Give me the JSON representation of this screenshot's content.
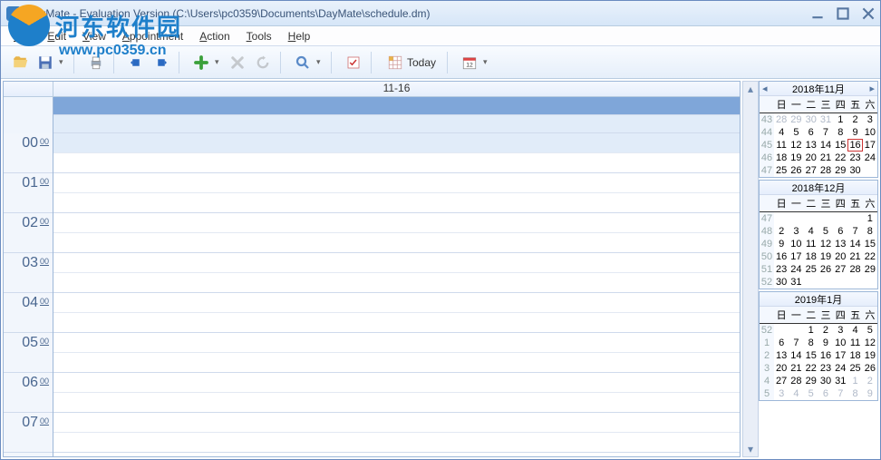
{
  "title": "DayMate - Evaluation Version (C:\\Users\\pc0359\\Documents\\DayMate\\schedule.dm)",
  "menu": {
    "file": "File",
    "edit": "Edit",
    "view": "View",
    "appointment": "Appointment",
    "action": "Action",
    "tools": "Tools",
    "help": "Help"
  },
  "toolbar": {
    "today": "Today"
  },
  "watermark": {
    "brand": "河东软件园",
    "url": "www.pc0359.cn"
  },
  "schedule": {
    "date_header": "11-16",
    "hours": [
      "00",
      "01",
      "02",
      "03",
      "04",
      "05",
      "06",
      "07"
    ],
    "minute_label": "00"
  },
  "calendars": [
    {
      "title": "2018年11月",
      "nav": true,
      "weekdays": [
        "日",
        "一",
        "二",
        "三",
        "四",
        "五",
        "六"
      ],
      "weeks": [
        {
          "wn": "43",
          "days": [
            {
              "d": "28",
              "dim": true
            },
            {
              "d": "29",
              "dim": true
            },
            {
              "d": "30",
              "dim": true
            },
            {
              "d": "31",
              "dim": true
            },
            {
              "d": "1"
            },
            {
              "d": "2"
            },
            {
              "d": "3"
            }
          ]
        },
        {
          "wn": "44",
          "days": [
            {
              "d": "4"
            },
            {
              "d": "5"
            },
            {
              "d": "6"
            },
            {
              "d": "7"
            },
            {
              "d": "8"
            },
            {
              "d": "9"
            },
            {
              "d": "10"
            }
          ]
        },
        {
          "wn": "45",
          "days": [
            {
              "d": "11"
            },
            {
              "d": "12"
            },
            {
              "d": "13"
            },
            {
              "d": "14"
            },
            {
              "d": "15"
            },
            {
              "d": "16",
              "today": true
            },
            {
              "d": "17"
            }
          ]
        },
        {
          "wn": "46",
          "days": [
            {
              "d": "18"
            },
            {
              "d": "19"
            },
            {
              "d": "20"
            },
            {
              "d": "21"
            },
            {
              "d": "22"
            },
            {
              "d": "23"
            },
            {
              "d": "24"
            }
          ]
        },
        {
          "wn": "47",
          "days": [
            {
              "d": "25"
            },
            {
              "d": "26"
            },
            {
              "d": "27"
            },
            {
              "d": "28"
            },
            {
              "d": "29"
            },
            {
              "d": "30"
            },
            {
              "d": ""
            }
          ]
        }
      ]
    },
    {
      "title": "2018年12月",
      "nav": false,
      "weekdays": [
        "日",
        "一",
        "二",
        "三",
        "四",
        "五",
        "六"
      ],
      "weeks": [
        {
          "wn": "47",
          "days": [
            {
              "d": ""
            },
            {
              "d": ""
            },
            {
              "d": ""
            },
            {
              "d": ""
            },
            {
              "d": ""
            },
            {
              "d": ""
            },
            {
              "d": "1"
            }
          ]
        },
        {
          "wn": "48",
          "days": [
            {
              "d": "2"
            },
            {
              "d": "3"
            },
            {
              "d": "4"
            },
            {
              "d": "5"
            },
            {
              "d": "6"
            },
            {
              "d": "7"
            },
            {
              "d": "8"
            }
          ]
        },
        {
          "wn": "49",
          "days": [
            {
              "d": "9"
            },
            {
              "d": "10"
            },
            {
              "d": "11"
            },
            {
              "d": "12"
            },
            {
              "d": "13"
            },
            {
              "d": "14"
            },
            {
              "d": "15"
            }
          ]
        },
        {
          "wn": "50",
          "days": [
            {
              "d": "16"
            },
            {
              "d": "17"
            },
            {
              "d": "18"
            },
            {
              "d": "19"
            },
            {
              "d": "20"
            },
            {
              "d": "21"
            },
            {
              "d": "22"
            }
          ]
        },
        {
          "wn": "51",
          "days": [
            {
              "d": "23"
            },
            {
              "d": "24"
            },
            {
              "d": "25"
            },
            {
              "d": "26"
            },
            {
              "d": "27"
            },
            {
              "d": "28"
            },
            {
              "d": "29"
            }
          ]
        },
        {
          "wn": "52",
          "days": [
            {
              "d": "30"
            },
            {
              "d": "31"
            },
            {
              "d": ""
            },
            {
              "d": ""
            },
            {
              "d": ""
            },
            {
              "d": ""
            },
            {
              "d": ""
            }
          ]
        }
      ]
    },
    {
      "title": "2019年1月",
      "nav": false,
      "weekdays": [
        "日",
        "一",
        "二",
        "三",
        "四",
        "五",
        "六"
      ],
      "weeks": [
        {
          "wn": "52",
          "days": [
            {
              "d": ""
            },
            {
              "d": ""
            },
            {
              "d": "1"
            },
            {
              "d": "2"
            },
            {
              "d": "3"
            },
            {
              "d": "4"
            },
            {
              "d": "5"
            }
          ]
        },
        {
          "wn": "1",
          "days": [
            {
              "d": "6"
            },
            {
              "d": "7"
            },
            {
              "d": "8"
            },
            {
              "d": "9"
            },
            {
              "d": "10"
            },
            {
              "d": "11"
            },
            {
              "d": "12"
            }
          ]
        },
        {
          "wn": "2",
          "days": [
            {
              "d": "13"
            },
            {
              "d": "14"
            },
            {
              "d": "15"
            },
            {
              "d": "16"
            },
            {
              "d": "17"
            },
            {
              "d": "18"
            },
            {
              "d": "19"
            }
          ]
        },
        {
          "wn": "3",
          "days": [
            {
              "d": "20"
            },
            {
              "d": "21"
            },
            {
              "d": "22"
            },
            {
              "d": "23"
            },
            {
              "d": "24"
            },
            {
              "d": "25"
            },
            {
              "d": "26"
            }
          ]
        },
        {
          "wn": "4",
          "days": [
            {
              "d": "27"
            },
            {
              "d": "28"
            },
            {
              "d": "29"
            },
            {
              "d": "30"
            },
            {
              "d": "31"
            },
            {
              "d": "1",
              "dim": true
            },
            {
              "d": "2",
              "dim": true
            }
          ]
        },
        {
          "wn": "5",
          "days": [
            {
              "d": "3",
              "dim": true
            },
            {
              "d": "4",
              "dim": true
            },
            {
              "d": "5",
              "dim": true
            },
            {
              "d": "6",
              "dim": true
            },
            {
              "d": "7",
              "dim": true
            },
            {
              "d": "8",
              "dim": true
            },
            {
              "d": "9",
              "dim": true
            }
          ]
        }
      ]
    }
  ]
}
